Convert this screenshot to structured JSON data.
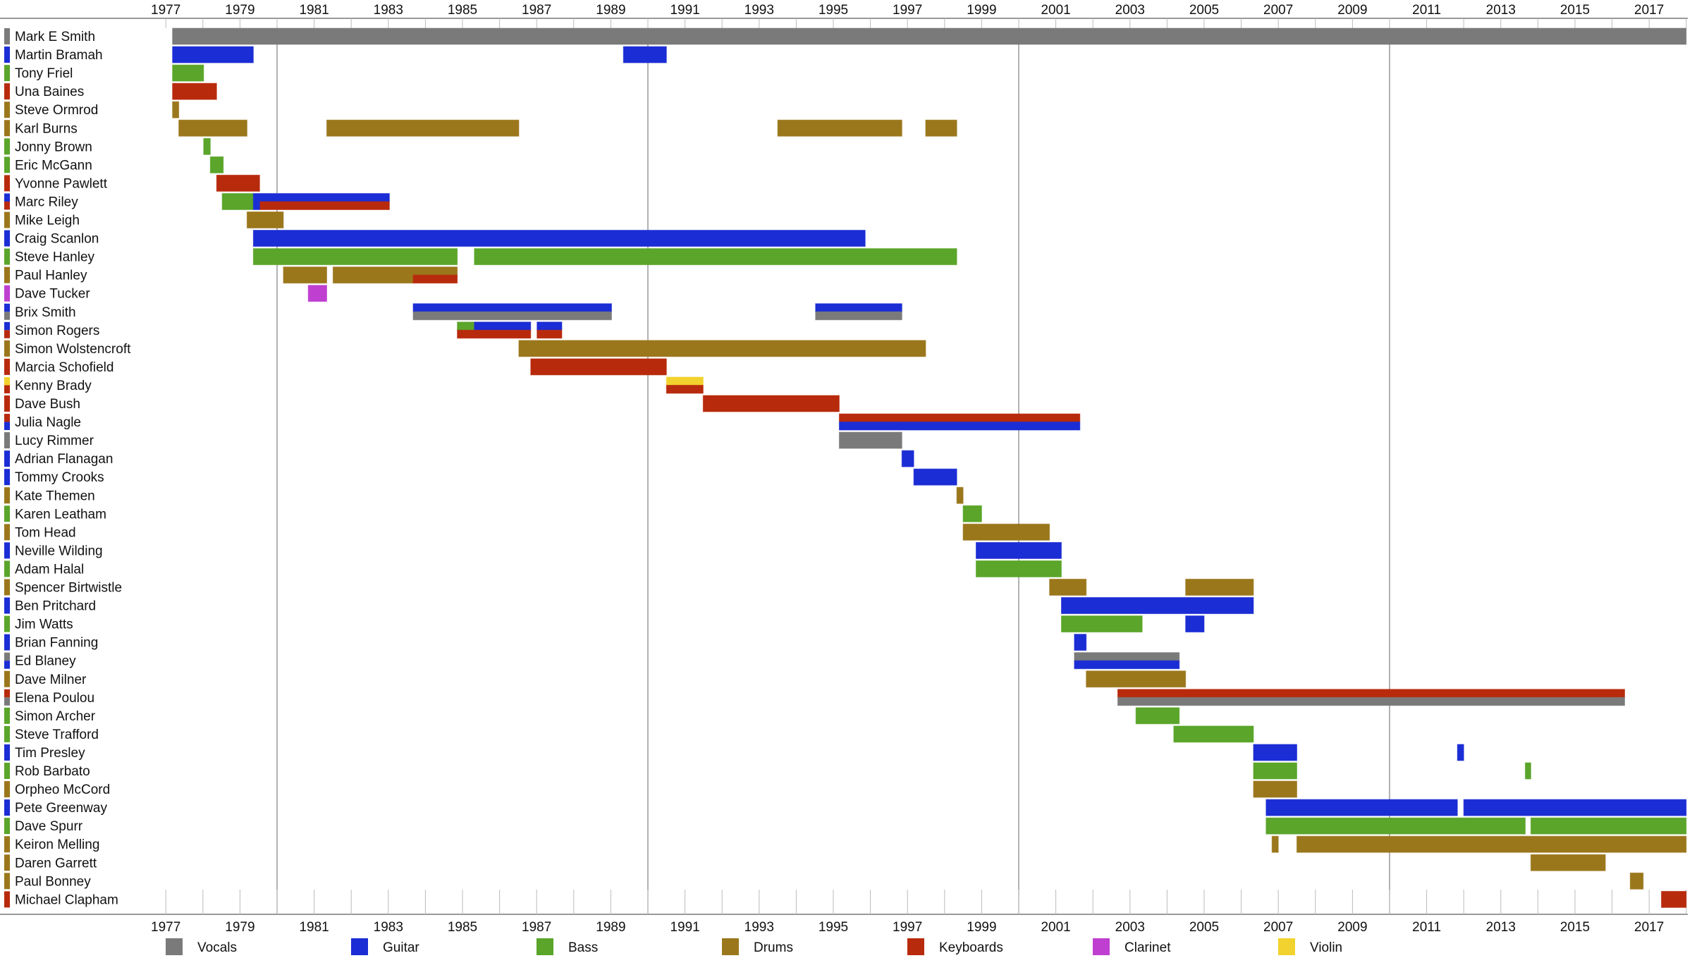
{
  "chart_data": {
    "type": "timeline",
    "title": "",
    "xlabel": "",
    "ylabel": "",
    "xlim": [
      1977,
      2018
    ],
    "tick_labels": [
      "1977",
      "1979",
      "1981",
      "1983",
      "1985",
      "1987",
      "1989",
      "1991",
      "1993",
      "1995",
      "1997",
      "1999",
      "2001",
      "2003",
      "2005",
      "2007",
      "2009",
      "2011",
      "2013",
      "2015",
      "2017"
    ],
    "major_gridlines": [
      1980,
      1990,
      2000,
      2010
    ],
    "legend_position": "bottom",
    "instruments": [
      {
        "name": "Vocals",
        "color": "#7a7a7a"
      },
      {
        "name": "Guitar",
        "color": "#1b2dd4"
      },
      {
        "name": "Bass",
        "color": "#5aa52a"
      },
      {
        "name": "Drums",
        "color": "#9b771c"
      },
      {
        "name": "Keyboards",
        "color": "#b82a0c"
      },
      {
        "name": "Clarinet",
        "color": "#bf3fd0"
      },
      {
        "name": "Violin",
        "color": "#f2d22e"
      }
    ],
    "members": [
      {
        "name": "Mark E Smith",
        "spans": [
          [
            "Vocals",
            1977.18,
            2018.0,
            "full"
          ]
        ]
      },
      {
        "name": "Martin Bramah",
        "spans": [
          [
            "Guitar",
            1977.18,
            1979.36,
            "full"
          ],
          [
            "Guitar",
            1989.34,
            1990.5,
            "full"
          ]
        ]
      },
      {
        "name": "Tony Friel",
        "spans": [
          [
            "Bass",
            1977.18,
            1978.02,
            "full"
          ]
        ]
      },
      {
        "name": "Una Baines",
        "spans": [
          [
            "Keyboards",
            1977.18,
            1978.37,
            "full"
          ]
        ]
      },
      {
        "name": "Steve Ormrod",
        "spans": [
          [
            "Drums",
            1977.18,
            1977.35,
            "full"
          ]
        ]
      },
      {
        "name": "Karl Burns",
        "spans": [
          [
            "Drums",
            1977.35,
            1979.19,
            "full"
          ],
          [
            "Drums",
            1981.34,
            1986.52,
            "full"
          ],
          [
            "Drums",
            1993.5,
            1996.85,
            "full"
          ],
          [
            "Drums",
            1997.49,
            1998.33,
            "full"
          ]
        ]
      },
      {
        "name": "Jonny Brown",
        "spans": [
          [
            "Bass",
            1978.02,
            1978.2,
            "full"
          ]
        ]
      },
      {
        "name": "Eric McGann",
        "spans": [
          [
            "Bass",
            1978.2,
            1978.55,
            "full"
          ]
        ]
      },
      {
        "name": "Yvonne Pawlett",
        "spans": [
          [
            "Keyboards",
            1978.37,
            1979.53,
            "full"
          ]
        ]
      },
      {
        "name": "Marc Riley",
        "spans": [
          [
            "Bass",
            1978.52,
            1979.36,
            "full"
          ],
          [
            "Guitar",
            1979.36,
            1983.03,
            "top"
          ],
          [
            "Keyboards",
            1979.53,
            1983.03,
            "bottom"
          ],
          [
            "Guitar",
            1979.36,
            1979.53,
            "bottom"
          ]
        ]
      },
      {
        "name": "Mike Leigh",
        "spans": [
          [
            "Drums",
            1979.19,
            1980.17,
            "full"
          ]
        ]
      },
      {
        "name": "Craig Scanlon",
        "spans": [
          [
            "Guitar",
            1979.36,
            1995.86,
            "full"
          ]
        ]
      },
      {
        "name": "Steve Hanley",
        "spans": [
          [
            "Bass",
            1979.36,
            1984.86,
            "full"
          ],
          [
            "Bass",
            1985.32,
            1998.33,
            "full"
          ]
        ]
      },
      {
        "name": "Paul Hanley",
        "spans": [
          [
            "Drums",
            1980.17,
            1981.34,
            "full"
          ],
          [
            "Drums",
            1981.51,
            1984.86,
            "top"
          ],
          [
            "Drums",
            1981.51,
            1983.67,
            "bottom"
          ],
          [
            "Keyboards",
            1983.67,
            1984.86,
            "bottom"
          ]
        ]
      },
      {
        "name": "Dave Tucker",
        "spans": [
          [
            "Clarinet",
            1980.84,
            1981.34,
            "full"
          ]
        ]
      },
      {
        "name": "Brix Smith",
        "spans": [
          [
            "Guitar",
            1983.67,
            1989.02,
            "top"
          ],
          [
            "Vocals",
            1983.67,
            1989.02,
            "bottom"
          ],
          [
            "Guitar",
            1994.52,
            1996.85,
            "top"
          ],
          [
            "Vocals",
            1994.52,
            1996.85,
            "bottom"
          ]
        ]
      },
      {
        "name": "Simon Rogers",
        "spans": [
          [
            "Bass",
            1984.86,
            1985.32,
            "top"
          ],
          [
            "Guitar",
            1985.32,
            1986.84,
            "top"
          ],
          [
            "Keyboards",
            1984.86,
            1986.84,
            "bottom"
          ],
          [
            "Guitar",
            1987.01,
            1987.68,
            "top"
          ],
          [
            "Keyboards",
            1987.01,
            1987.68,
            "bottom"
          ]
        ]
      },
      {
        "name": "Simon Wolstencroft",
        "spans": [
          [
            "Drums",
            1986.52,
            1997.49,
            "full"
          ]
        ]
      },
      {
        "name": "Marcia Schofield",
        "spans": [
          [
            "Keyboards",
            1986.84,
            1990.5,
            "full"
          ]
        ]
      },
      {
        "name": "Kenny Brady",
        "spans": [
          [
            "Violin",
            1990.5,
            1991.49,
            "top"
          ],
          [
            "Keyboards",
            1990.5,
            1991.49,
            "bottom"
          ]
        ]
      },
      {
        "name": "Dave Bush",
        "spans": [
          [
            "Keyboards",
            1991.49,
            1995.16,
            "full"
          ]
        ]
      },
      {
        "name": "Julia Nagle",
        "spans": [
          [
            "Keyboards",
            1995.16,
            2001.65,
            "top"
          ],
          [
            "Guitar",
            1995.16,
            2001.65,
            "bottom"
          ]
        ]
      },
      {
        "name": "Lucy Rimmer",
        "spans": [
          [
            "Vocals",
            1995.16,
            1996.85,
            "full"
          ]
        ]
      },
      {
        "name": "Adrian Flanagan",
        "spans": [
          [
            "Guitar",
            1996.85,
            1997.17,
            "full"
          ]
        ]
      },
      {
        "name": "Tommy Crooks",
        "spans": [
          [
            "Guitar",
            1997.17,
            1998.33,
            "full"
          ]
        ]
      },
      {
        "name": "Kate Themen",
        "spans": [
          [
            "Drums",
            1998.33,
            1998.5,
            "full"
          ]
        ]
      },
      {
        "name": "Karen Leatham",
        "spans": [
          [
            "Bass",
            1998.5,
            1999.0,
            "full"
          ]
        ]
      },
      {
        "name": "Tom Head",
        "spans": [
          [
            "Drums",
            1998.5,
            2000.83,
            "full"
          ]
        ]
      },
      {
        "name": "Neville Wilding",
        "spans": [
          [
            "Guitar",
            1998.85,
            2001.15,
            "full"
          ]
        ]
      },
      {
        "name": "Adam Halal",
        "spans": [
          [
            "Bass",
            1998.85,
            2001.15,
            "full"
          ]
        ]
      },
      {
        "name": "Spencer Birtwistle",
        "spans": [
          [
            "Drums",
            2000.83,
            2001.82,
            "full"
          ],
          [
            "Drums",
            2004.5,
            2006.33,
            "full"
          ]
        ]
      },
      {
        "name": "Ben Pritchard",
        "spans": [
          [
            "Guitar",
            2001.15,
            2006.33,
            "full"
          ]
        ]
      },
      {
        "name": "Jim Watts",
        "spans": [
          [
            "Bass",
            2001.15,
            2003.33,
            "full"
          ],
          [
            "Guitar",
            2004.5,
            2005.0,
            "full"
          ]
        ]
      },
      {
        "name": "Brian Fanning",
        "spans": [
          [
            "Guitar",
            2001.5,
            2001.82,
            "full"
          ]
        ]
      },
      {
        "name": "Ed Blaney",
        "spans": [
          [
            "Vocals",
            2001.5,
            2004.33,
            "top"
          ],
          [
            "Guitar",
            2001.5,
            2004.33,
            "bottom"
          ]
        ]
      },
      {
        "name": "Dave Milner",
        "spans": [
          [
            "Drums",
            2001.82,
            2004.5,
            "full"
          ]
        ]
      },
      {
        "name": "Elena Poulou",
        "spans": [
          [
            "Keyboards",
            2002.67,
            2016.34,
            "top"
          ],
          [
            "Vocals",
            2002.67,
            2016.34,
            "bottom"
          ]
        ]
      },
      {
        "name": "Simon Archer",
        "spans": [
          [
            "Bass",
            2003.16,
            2004.33,
            "full"
          ]
        ]
      },
      {
        "name": "Steve Trafford",
        "spans": [
          [
            "Bass",
            2004.18,
            2006.33,
            "full"
          ]
        ]
      },
      {
        "name": "Tim Presley",
        "spans": [
          [
            "Guitar",
            2006.33,
            2007.5,
            "full"
          ],
          [
            "Guitar",
            2011.83,
            2012.0,
            "full"
          ]
        ]
      },
      {
        "name": "Rob Barbato",
        "spans": [
          [
            "Bass",
            2006.33,
            2007.5,
            "full"
          ],
          [
            "Bass",
            2013.66,
            2013.81,
            "full"
          ]
        ]
      },
      {
        "name": "Orpheo McCord",
        "spans": [
          [
            "Drums",
            2006.33,
            2007.5,
            "full"
          ]
        ]
      },
      {
        "name": "Pete Greenway",
        "spans": [
          [
            "Guitar",
            2006.67,
            2011.83,
            "full"
          ],
          [
            "Guitar",
            2012.0,
            2018.0,
            "full"
          ]
        ]
      },
      {
        "name": "Dave Spurr",
        "spans": [
          [
            "Bass",
            2006.67,
            2013.66,
            "full"
          ],
          [
            "Bass",
            2013.81,
            2018.0,
            "full"
          ]
        ]
      },
      {
        "name": "Keiron Melling",
        "spans": [
          [
            "Drums",
            2006.83,
            2007.0,
            "full"
          ],
          [
            "Drums",
            2007.5,
            2018.0,
            "full"
          ]
        ]
      },
      {
        "name": "Daren Garrett",
        "spans": [
          [
            "Drums",
            2013.81,
            2015.82,
            "full"
          ]
        ]
      },
      {
        "name": "Paul Bonney",
        "spans": [
          [
            "Drums",
            2016.49,
            2016.84,
            "full"
          ]
        ]
      },
      {
        "name": "Michael Clapham",
        "spans": [
          [
            "Keyboards",
            2017.33,
            2018.0,
            "full"
          ]
        ]
      }
    ],
    "member_label_colors": {
      "Mark E Smith": [
        "Vocals"
      ],
      "Martin Bramah": [
        "Guitar"
      ],
      "Tony Friel": [
        "Bass"
      ],
      "Una Baines": [
        "Keyboards"
      ],
      "Steve Ormrod": [
        "Drums"
      ],
      "Karl Burns": [
        "Drums"
      ],
      "Jonny Brown": [
        "Bass"
      ],
      "Eric McGann": [
        "Bass"
      ],
      "Yvonne Pawlett": [
        "Keyboards"
      ],
      "Marc Riley": [
        "Guitar",
        "Keyboards"
      ],
      "Mike Leigh": [
        "Drums"
      ],
      "Craig Scanlon": [
        "Guitar"
      ],
      "Steve Hanley": [
        "Bass"
      ],
      "Paul Hanley": [
        "Drums"
      ],
      "Dave Tucker": [
        "Clarinet"
      ],
      "Brix Smith": [
        "Guitar",
        "Vocals"
      ],
      "Simon Rogers": [
        "Guitar",
        "Keyboards"
      ],
      "Simon Wolstencroft": [
        "Drums"
      ],
      "Marcia Schofield": [
        "Keyboards"
      ],
      "Kenny Brady": [
        "Violin",
        "Keyboards"
      ],
      "Dave Bush": [
        "Keyboards"
      ],
      "Julia Nagle": [
        "Keyboards",
        "Guitar"
      ],
      "Lucy Rimmer": [
        "Vocals"
      ],
      "Adrian Flanagan": [
        "Guitar"
      ],
      "Tommy Crooks": [
        "Guitar"
      ],
      "Kate Themen": [
        "Drums"
      ],
      "Karen Leatham": [
        "Bass"
      ],
      "Tom Head": [
        "Drums"
      ],
      "Neville Wilding": [
        "Guitar"
      ],
      "Adam Halal": [
        "Bass"
      ],
      "Spencer Birtwistle": [
        "Drums"
      ],
      "Ben Pritchard": [
        "Guitar"
      ],
      "Jim Watts": [
        "Bass"
      ],
      "Brian Fanning": [
        "Guitar"
      ],
      "Ed Blaney": [
        "Vocals",
        "Guitar"
      ],
      "Dave Milner": [
        "Drums"
      ],
      "Elena Poulou": [
        "Keyboards",
        "Vocals"
      ],
      "Simon Archer": [
        "Bass"
      ],
      "Steve Trafford": [
        "Bass"
      ],
      "Tim Presley": [
        "Guitar"
      ],
      "Rob Barbato": [
        "Bass"
      ],
      "Orpheo McCord": [
        "Drums"
      ],
      "Pete Greenway": [
        "Guitar"
      ],
      "Dave Spurr": [
        "Bass"
      ],
      "Keiron Melling": [
        "Drums"
      ],
      "Daren Garrett": [
        "Drums"
      ],
      "Paul Bonney": [
        "Drums"
      ],
      "Michael Clapham": [
        "Keyboards"
      ]
    }
  }
}
